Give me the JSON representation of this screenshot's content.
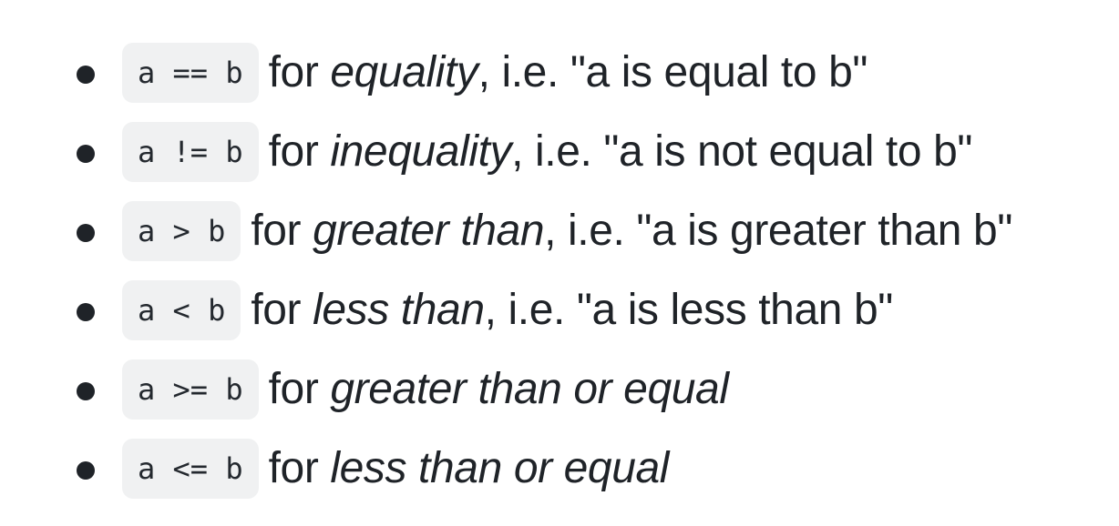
{
  "operators": [
    {
      "code": "a == b",
      "prefix": "for ",
      "term": "equality",
      "suffix": ", i.e. \"a is equal to b\""
    },
    {
      "code": "a != b",
      "prefix": "for ",
      "term": "inequality",
      "suffix": ", i.e. \"a is not equal to b\""
    },
    {
      "code": "a > b",
      "prefix": "for ",
      "term": "greater than",
      "suffix": ", i.e. \"a is greater than b\""
    },
    {
      "code": "a < b",
      "prefix": "for ",
      "term": "less than",
      "suffix": ", i.e. \"a is less than b\""
    },
    {
      "code": "a >= b",
      "prefix": "for ",
      "term": "greater than or equal",
      "suffix": ""
    },
    {
      "code": "a <= b",
      "prefix": "for ",
      "term": "less than or equal",
      "suffix": ""
    }
  ]
}
